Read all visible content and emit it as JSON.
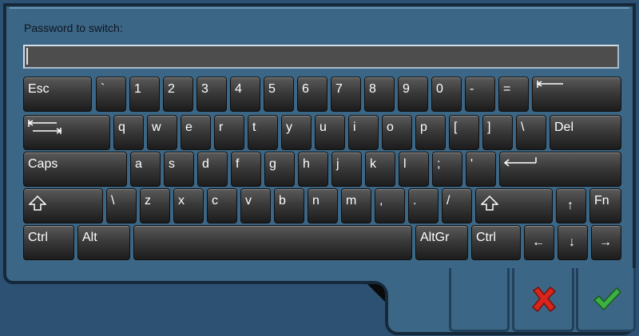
{
  "dialog": {
    "prompt": "Password to switch:",
    "password_value": ""
  },
  "keys": {
    "r1": [
      "Esc",
      "`",
      "1",
      "2",
      "3",
      "4",
      "5",
      "6",
      "7",
      "8",
      "9",
      "0",
      "-",
      "="
    ],
    "r2": [
      "q",
      "w",
      "e",
      "r",
      "t",
      "y",
      "u",
      "i",
      "o",
      "p",
      "[",
      "]",
      "\\",
      "Del"
    ],
    "r3": [
      "Caps",
      "a",
      "s",
      "d",
      "f",
      "g",
      "h",
      "j",
      "k",
      "l",
      ";",
      "'"
    ],
    "r4": [
      "\\",
      "z",
      "x",
      "c",
      "v",
      "b",
      "n",
      "m",
      ",",
      ".",
      "/",
      "↑",
      "Fn"
    ],
    "r5": [
      "Ctrl",
      "Alt",
      "AltGr",
      "Ctrl",
      "←",
      "↓",
      "→"
    ]
  },
  "icons": {
    "backspace": "backspace-arrow-icon",
    "tab": "tab-arrow-icon",
    "enter": "enter-arrow-icon",
    "shift": "shift-arrow-icon",
    "cancel": "cancel-x-icon",
    "ok": "ok-checkmark-icon"
  },
  "colors": {
    "cancel": "#d9261c",
    "ok": "#3cb043"
  }
}
